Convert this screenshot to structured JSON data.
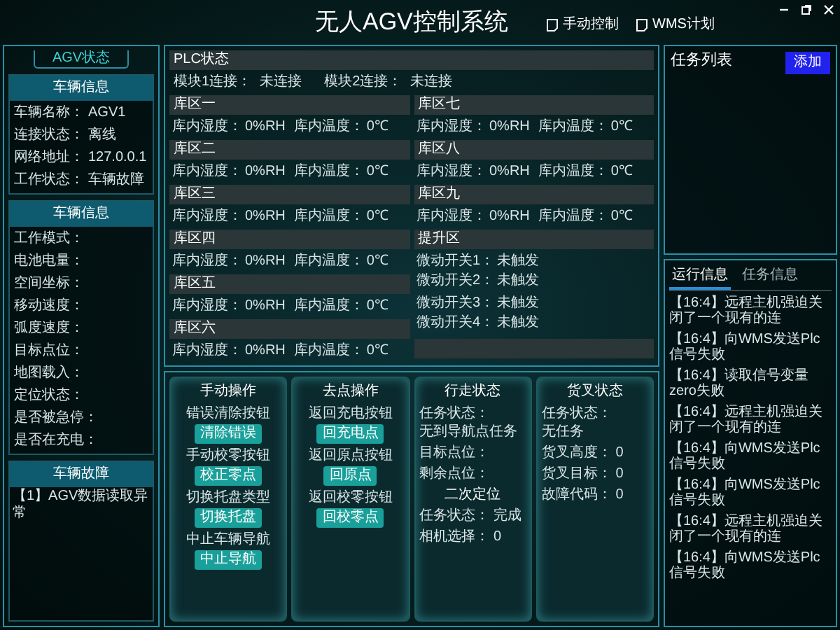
{
  "window": {
    "title": "无人AGV控制系统"
  },
  "header_buttons": [
    "手动控制",
    "WMS计划"
  ],
  "left_panel": {
    "tab": "AGV状态",
    "sections": [
      {
        "title": "车辆信息",
        "rows": [
          [
            {
              "label": "车辆名称：",
              "value": "AGV1"
            }
          ],
          [
            {
              "label": "连接状态：",
              "value": "离线"
            }
          ],
          [
            {
              "label": "网络地址：",
              "value": "127.0.0.1"
            }
          ],
          [
            {
              "label": "工作状态：",
              "value": "车辆故障"
            }
          ]
        ]
      },
      {
        "title": "车辆信息",
        "rows": [
          [
            {
              "label": "工作模式："
            }
          ],
          [
            {
              "label": "电池电量："
            }
          ],
          [
            {
              "label": "空间坐标："
            }
          ],
          [
            {
              "label": "移动速度："
            },
            {
              "label": "弧度速度："
            }
          ],
          [
            {
              "label": "目标点位："
            }
          ],
          [
            {
              "label": "地图载入："
            }
          ],
          [
            {
              "label": "定位状态："
            }
          ],
          [
            {
              "label": "是否被急停："
            },
            {
              "label": "是否在充电："
            }
          ]
        ]
      }
    ],
    "fault": {
      "title": "车辆故障",
      "items": [
        "【1】AGV数据读取异常"
      ]
    }
  },
  "plc": {
    "title": "PLC状态",
    "fields": [
      {
        "label": "模块1连接：",
        "value": "未连接"
      },
      {
        "label": "模块2连接：",
        "value": "未连接"
      }
    ],
    "columns": [
      [
        {
          "title": "库区一",
          "rows": [
            [
              {
                "label": "库内湿度：",
                "value": "0%RH"
              },
              {
                "label": "库内温度：",
                "value": "0℃"
              }
            ]
          ]
        },
        {
          "title": "库区二",
          "rows": [
            [
              {
                "label": "库内湿度：",
                "value": "0%RH"
              },
              {
                "label": "库内温度：",
                "value": "0℃"
              }
            ]
          ]
        },
        {
          "title": "库区三",
          "rows": [
            [
              {
                "label": "库内湿度：",
                "value": "0%RH"
              },
              {
                "label": "库内温度：",
                "value": "0℃"
              }
            ]
          ]
        },
        {
          "title": "库区四",
          "rows": [
            [
              {
                "label": "库内湿度：",
                "value": "0%RH"
              },
              {
                "label": "库内温度：",
                "value": "0℃"
              }
            ]
          ]
        },
        {
          "title": "库区五",
          "rows": [
            [
              {
                "label": "库内湿度：",
                "value": "0%RH"
              },
              {
                "label": "库内温度：",
                "value": "0℃"
              }
            ]
          ]
        },
        {
          "title": "库区六",
          "rows": [
            [
              {
                "label": "库内湿度：",
                "value": "0%RH"
              },
              {
                "label": "库内温度：",
                "value": "0℃"
              }
            ]
          ]
        }
      ],
      [
        {
          "title": "库区七",
          "rows": [
            [
              {
                "label": "库内湿度：",
                "value": "0%RH"
              },
              {
                "label": "库内温度：",
                "value": "0℃"
              }
            ]
          ]
        },
        {
          "title": "库区八",
          "rows": [
            [
              {
                "label": "库内湿度：",
                "value": "0%RH"
              },
              {
                "label": "库内温度：",
                "value": "0℃"
              }
            ]
          ]
        },
        {
          "title": "库区九",
          "rows": [
            [
              {
                "label": "库内湿度：",
                "value": "0%RH"
              },
              {
                "label": "库内温度：",
                "value": "0℃"
              }
            ]
          ]
        },
        {
          "title": "提升区",
          "rows": [
            [
              {
                "label": "微动开关1：",
                "value": "未触发"
              },
              {
                "label": "微动开关2：",
                "value": "未触发"
              }
            ],
            [
              {
                "label": "微动开关3：",
                "value": "未触发"
              },
              {
                "label": "微动开关4：",
                "value": "未触发"
              }
            ]
          ]
        }
      ]
    ]
  },
  "operations": [
    {
      "title": "手动操作",
      "kind": "buttons",
      "rows": [
        {
          "label": "错误清除按钮",
          "button": "清除错误"
        },
        {
          "label": "手动校零按钮",
          "button": "校正零点"
        },
        {
          "label": "切换托盘类型",
          "button": "切换托盘"
        },
        {
          "label": "中止车辆导航",
          "button": "中止导航"
        }
      ]
    },
    {
      "title": "去点操作",
      "kind": "buttons",
      "rows": [
        {
          "label": "返回充电按钮",
          "button": "回充电点"
        },
        {
          "label": "返回原点按钮",
          "button": "回原点"
        },
        {
          "label": "返回校零按钮",
          "button": "回校零点"
        }
      ]
    },
    {
      "title": "行走状态",
      "kind": "status",
      "rows": [
        {
          "kind": "field",
          "label": "任务状态：",
          "value": "无到导航点任务"
        },
        {
          "kind": "field",
          "label": "目标点位："
        },
        {
          "kind": "field",
          "label": "剩余点位："
        },
        {
          "kind": "heading",
          "text": "二次定位"
        },
        {
          "kind": "field",
          "label": "任务状态：",
          "value": "完成"
        },
        {
          "kind": "field",
          "label": "相机选择：",
          "value": "0"
        }
      ]
    },
    {
      "title": "货叉状态",
      "kind": "status",
      "rows": [
        {
          "kind": "field",
          "label": "任务状态：",
          "value": "无任务"
        },
        {
          "kind": "field",
          "label": "货叉高度：",
          "value": "0"
        },
        {
          "kind": "field",
          "label": "货叉目标：",
          "value": "0"
        },
        {
          "kind": "field",
          "label": "故障代码：",
          "value": "0"
        }
      ]
    }
  ],
  "task_list": {
    "title": "任务列表",
    "add_button": "添加"
  },
  "log_tabs": [
    {
      "label": "运行信息",
      "selected": true
    },
    {
      "label": "任务信息",
      "selected": false
    }
  ],
  "log": [
    "【16:4】远程主机强迫关闭了一个现有的连",
    "【16:4】向WMS发送Plc信号失败",
    "【16:4】读取信号变量zero失败",
    "【16:4】远程主机强迫关闭了一个现有的连",
    "【16:4】向WMS发送Plc信号失败",
    "【16:4】向WMS发送Plc信号失败",
    "【16:4】远程主机强迫关闭了一个现有的连",
    "【16:4】向WMS发送Plc信号失败"
  ]
}
